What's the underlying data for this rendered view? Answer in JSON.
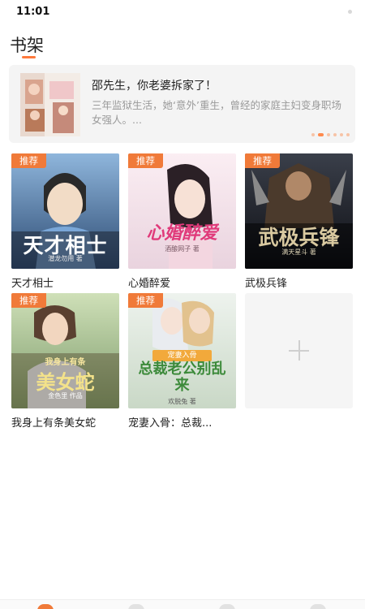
{
  "status_bar": {
    "time": "11:01"
  },
  "page": {
    "title": "书架"
  },
  "featured": {
    "title": "邵先生，你老婆拆家了！",
    "description": "三年监狱生活，她‘意外’重生，曾经的家庭主妇变身职场女强人。...",
    "carousel_pages": 6,
    "carousel_active": 1
  },
  "badge_label": "推荐",
  "books": [
    {
      "title": "天才相士",
      "cover_text": "天才相士",
      "cover_author": "潜龙勿用 著",
      "badge": "推荐",
      "colors": {
        "bg1": "#8fb6dc",
        "bg2": "#2c4a72",
        "accent": "#f2dcc6"
      }
    },
    {
      "title": "心婚醉爱",
      "cover_text": "心婚醉爱",
      "cover_author": "酒酿网子 著",
      "badge": "推荐",
      "colors": {
        "bg1": "#fbeef3",
        "bg2": "#e9d3de",
        "accent": "#e03a7a"
      }
    },
    {
      "title": "武极兵锋",
      "cover_text": "武极兵锋",
      "cover_author": "满天星斗 著",
      "badge": "推荐",
      "colors": {
        "bg1": "#3a3f4a",
        "bg2": "#0e0f14",
        "accent": "#d9c9a0"
      }
    },
    {
      "title": "我身上有条美女蛇",
      "cover_text": "美女蛇",
      "cover_subtitle": "我身上有条",
      "cover_author": "金色里 作品",
      "badge": "推荐",
      "colors": {
        "bg1": "#cfe0b8",
        "bg2": "#7c9a6a",
        "accent": "#f3e28a"
      }
    },
    {
      "title": "宠妻入骨：总裁...",
      "cover_text": "总裁老公别乱来",
      "cover_subtitle": "宠妻入骨",
      "cover_author": "欢脱兔 著",
      "badge": "推荐",
      "colors": {
        "bg1": "#eef3ee",
        "bg2": "#c9d8c6",
        "accent": "#3c8a3a"
      }
    }
  ],
  "add_button": {
    "icon": "plus-icon"
  },
  "tabbar": {
    "items": [
      "bookshelf-icon",
      "bookstore-icon",
      "category-icon",
      "profile-icon"
    ],
    "active_index": 0
  }
}
